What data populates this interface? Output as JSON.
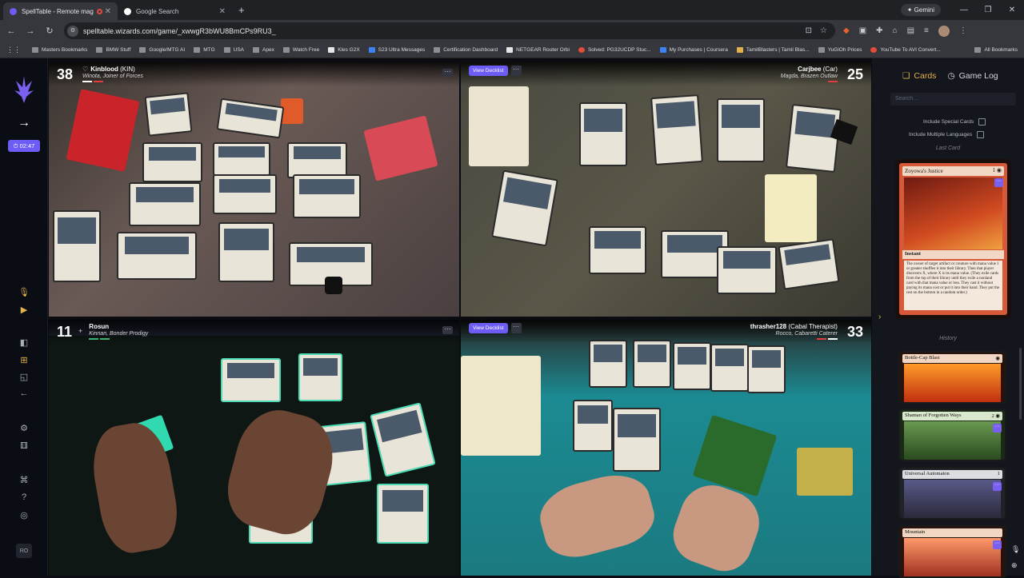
{
  "browser": {
    "tabs": [
      {
        "title": "SpellTable - Remote magic madn",
        "active": true
      },
      {
        "title": "Google Search",
        "active": false
      }
    ],
    "gemini_label": "Gemini",
    "url": "spelltable.wizards.com/game/_xwwgR3bWU8BmCPs9RU3_",
    "bookmarks": [
      "Masters Bookmarks",
      "BMW Stuff",
      "Google/MTG AI",
      "MTG",
      "USA",
      "Apex",
      "Watch Free",
      "Kles G2X",
      "S23 Ultra Messages",
      "Certification Dashboard",
      "NETGEAR Router Orbi",
      "Solved: PG32UCDP Stuc...",
      "My Purchases | Coursera",
      "TamilBlasters | Tamil Blas...",
      "YuGiOh Prices",
      "YouTube To AVI Convert..."
    ],
    "all_bookmarks": "All Bookmarks"
  },
  "sidebar": {
    "timer": "02:47",
    "user_initials": "RO"
  },
  "players": [
    {
      "life": "38",
      "name": "Kinblood",
      "tag": "(KIN)",
      "commander": "Winota, Joiner of Forces"
    },
    {
      "life": "25",
      "name": "Carjbee",
      "tag": "(Car)",
      "commander": "Magda, Brazen Outlaw",
      "view_decklist": "View Decklist"
    },
    {
      "life": "11",
      "name": "Rosun",
      "tag": "",
      "commander": "Kinnan, Bonder Prodigy"
    },
    {
      "life": "33",
      "name": "thrasher128",
      "tag": "(Cabal Therapist)",
      "commander": "Rocco, Cabaretti Caterer",
      "view_decklist": "View Decklist"
    }
  ],
  "panel": {
    "tab_cards": "Cards",
    "tab_gamelog": "Game Log",
    "search_placeholder": "Search...",
    "include_special": "Include Special Cards",
    "include_languages": "Include Multiple Languages",
    "last_card_label": "Last Card",
    "history_label": "History",
    "last_card": {
      "name": "Zoyowa's Justice",
      "type": "Instant",
      "text": "The owner of target artifact or creature with mana value 1 or greater shuffles it into their library. Then that player discovers X, where X is its mana value. (They exile cards from the top of their library until they exile a nonland card with that mana value or less. They cast it without paying its mana cost or put it into their hand. They put the rest on the bottom in a random order.)"
    },
    "history": [
      {
        "name": "Bottle-Cap Blast",
        "color": "#e8805a"
      },
      {
        "name": "Shaman of Forgotten Ways",
        "color": "#8fc48a"
      },
      {
        "name": "Universal Automaton",
        "color": "#c6c8cc"
      },
      {
        "name": "Mountain",
        "color": "#e8805a"
      }
    ]
  },
  "colors": {
    "accent": "#6d5cf5",
    "panel_gold": "#e5b14a"
  }
}
